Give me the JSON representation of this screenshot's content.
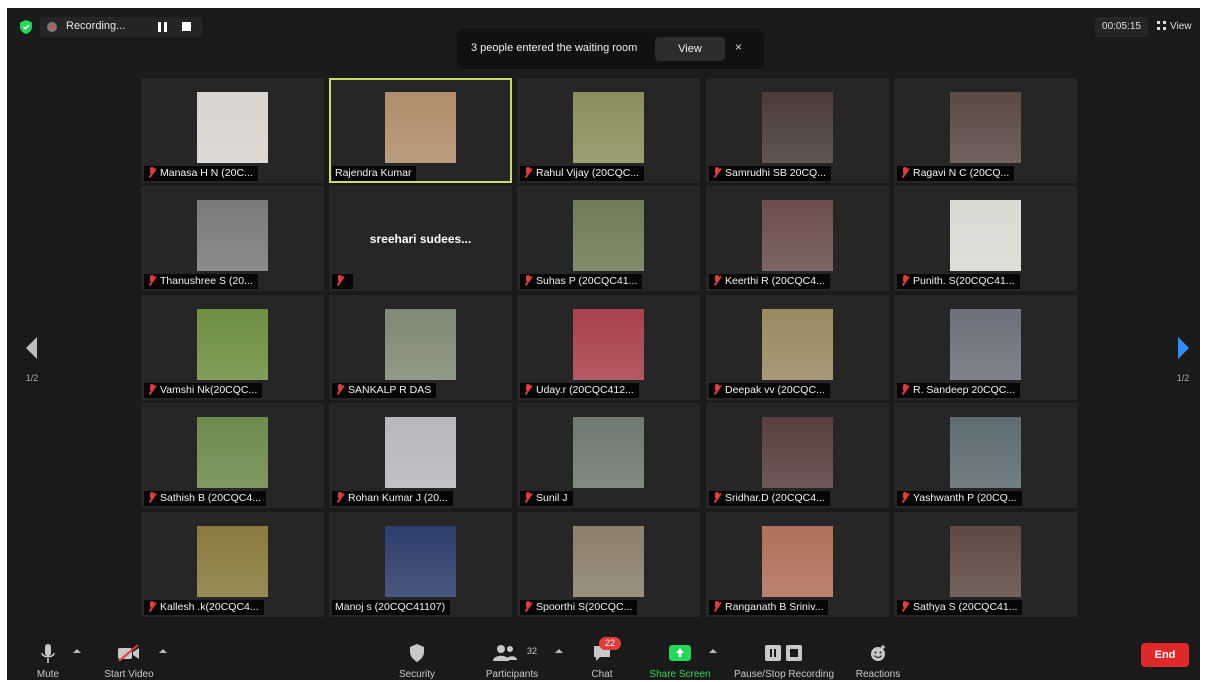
{
  "recording": {
    "label": "Recording..."
  },
  "notification": {
    "message": "3 people entered the waiting room",
    "view_label": "View",
    "close_label": "×"
  },
  "timer": "00:05:15",
  "view_label": "View",
  "pager": {
    "left": "1/2",
    "right": "1/2"
  },
  "participants": [
    {
      "name": "Manasa H N (20C...",
      "muted": true,
      "photo_color": "#d9d3cf"
    },
    {
      "name": "Rajendra Kumar",
      "muted": false,
      "active": true,
      "photo_color": "#b08d6a"
    },
    {
      "name": "Rahul Vijay (20CQC...",
      "muted": true,
      "photo_color": "#8c8f5c"
    },
    {
      "name": "Samrudhi SB 20CQ...",
      "muted": true,
      "photo_color": "#4a3b36"
    },
    {
      "name": "Ragavi N C (20CQ...",
      "muted": true,
      "photo_color": "#5b4a44"
    },
    {
      "name": "Thanushree S (20...",
      "muted": true,
      "photo_color": "#7a7a7a"
    },
    {
      "name": "",
      "display_name": "sreehari sudees...",
      "muted": true,
      "no_video": true
    },
    {
      "name": "Suhas P (20CQC41...",
      "muted": true,
      "photo_color": "#6f7b58"
    },
    {
      "name": "Keerthi R (20CQC4...",
      "muted": true,
      "photo_color": "#6b4e4a"
    },
    {
      "name": "Punith. S(20CQC41...",
      "muted": true,
      "photo_color": "#d8dbd2"
    },
    {
      "name": "Vamshi Nk(20CQC...",
      "muted": true,
      "photo_color": "#6f8f42"
    },
    {
      "name": "SANKALP R DAS",
      "muted": true,
      "photo_color": "#7e8a75"
    },
    {
      "name": "Uday.r (20CQC412...",
      "muted": true,
      "photo_color": "#a8414a"
    },
    {
      "name": "Deepak vv (20CQC...",
      "muted": true,
      "photo_color": "#9a8a62"
    },
    {
      "name": "R. Sandeep 20CQC...",
      "muted": true,
      "photo_color": "#6d6f7a"
    },
    {
      "name": "Sathish B (20CQC4...",
      "muted": true,
      "photo_color": "#6e8a4b"
    },
    {
      "name": "Rohan Kumar J (20...",
      "muted": true,
      "photo_color": "#b9b6bd"
    },
    {
      "name": "Sunil J",
      "muted": true,
      "photo_color": "#6d7a6e"
    },
    {
      "name": "Sridhar.D (20CQC4...",
      "muted": true,
      "photo_color": "#5a3f3c"
    },
    {
      "name": "Yashwanth P (20CQ...",
      "muted": true,
      "photo_color": "#5d6c6f"
    },
    {
      "name": "Kallesh .k(20CQC4...",
      "muted": true,
      "photo_color": "#8a7a3e"
    },
    {
      "name": "Manoj s (20CQC41107)",
      "muted": false,
      "photo_color": "#2d3e6b"
    },
    {
      "name": "Spoorthi S(20CQC...",
      "muted": true,
      "photo_color": "#8c7f6b"
    },
    {
      "name": "Ranganath B Sriniv...",
      "muted": true,
      "photo_color": "#b0705a"
    },
    {
      "name": "Sathya S (20CQC41...",
      "muted": true,
      "photo_color": "#5e4a44"
    }
  ],
  "toolbar": {
    "mute": "Mute",
    "start_video": "Start Video",
    "security": "Security",
    "participants": "Participants",
    "participants_count": "32",
    "chat": "Chat",
    "chat_badge": "22",
    "share_screen": "Share Screen",
    "pause_recording": "Pause/Stop Recording",
    "reactions": "Reactions",
    "end": "End"
  },
  "colors": {
    "accent_green": "#23d959",
    "active_outline": "#c9df5f",
    "end_red": "#e02828",
    "muted_red": "#e23b3b"
  }
}
